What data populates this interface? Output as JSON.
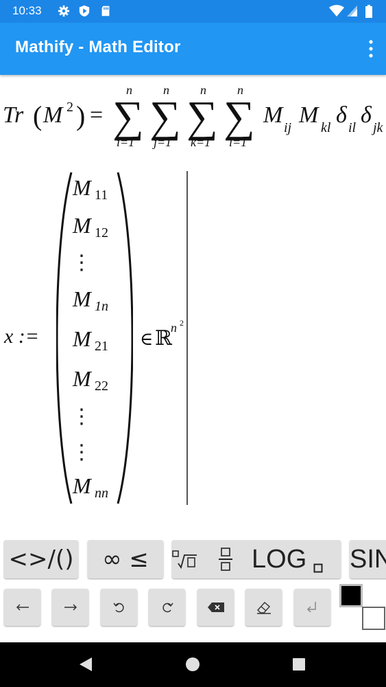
{
  "status": {
    "time": "10:33"
  },
  "app": {
    "title": "Mathify - Math Editor"
  },
  "equations": {
    "trace": {
      "lhs_name": "Tr",
      "lhs_arg": "M",
      "lhs_exp": "2",
      "equals": "=",
      "sum_upper": "n",
      "sum_indices": [
        "i=1",
        "j=1",
        "k=1",
        "l=1"
      ],
      "terms": [
        {
          "base": "M",
          "sub": "ij"
        },
        {
          "base": "M",
          "sub": "kl"
        },
        {
          "base": "δ",
          "sub": "il"
        },
        {
          "base": "δ",
          "sub": "jk"
        }
      ]
    },
    "vector": {
      "lhs": "x :=",
      "entries": [
        {
          "base": "M",
          "sub": "11"
        },
        {
          "base": "M",
          "sub": "12"
        },
        {
          "base": "⋮",
          "sub": ""
        },
        {
          "base": "M",
          "sub": "1n"
        },
        {
          "base": "M",
          "sub": "21"
        },
        {
          "base": "M",
          "sub": "22"
        },
        {
          "base": "⋮",
          "sub": ""
        },
        {
          "base": "⋮",
          "sub": ""
        },
        {
          "base": "M",
          "sub": "nn"
        }
      ],
      "member": "∈",
      "set": "ℝ",
      "set_exp_base": "n",
      "set_exp_exp": "2"
    }
  },
  "keyboard": {
    "tabs": [
      {
        "label": "<>/()"
      },
      {
        "label": "∞ ≤"
      },
      {
        "label": "LOG"
      },
      {
        "label": "SIN"
      }
    ],
    "nav_keys": [
      "left-arrow",
      "right-arrow",
      "undo",
      "redo",
      "backspace",
      "eraser",
      "enter"
    ]
  },
  "colors": {
    "statusbar": "#1c86e6",
    "appbar": "#2196f3",
    "key": "#e0e0e0"
  }
}
